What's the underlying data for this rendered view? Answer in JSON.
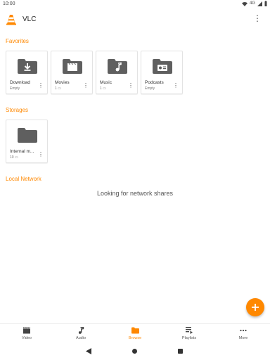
{
  "status": {
    "time": "10:00",
    "network": "4G"
  },
  "app": {
    "title": "VLC"
  },
  "favorites": {
    "title": "Favorites",
    "items": [
      {
        "name": "Download",
        "sub": "Empty",
        "icon": "download-folder-icon"
      },
      {
        "name": "Movies",
        "sub": "1",
        "icon": "movies-folder-icon"
      },
      {
        "name": "Music",
        "sub": "1",
        "icon": "music-folder-icon"
      },
      {
        "name": "Podcasts",
        "sub": "Empty",
        "icon": "podcasts-folder-icon"
      }
    ]
  },
  "storages": {
    "title": "Storages",
    "items": [
      {
        "name": "Internal m...",
        "sub": "10",
        "icon": "folder-icon"
      }
    ]
  },
  "network": {
    "title": "Local Network",
    "message": "Looking for network shares"
  },
  "nav": [
    {
      "label": "Video",
      "icon": "video-icon"
    },
    {
      "label": "Audio",
      "icon": "audio-icon"
    },
    {
      "label": "Browse",
      "icon": "browse-folder-icon",
      "active": true
    },
    {
      "label": "Playlists",
      "icon": "playlist-icon"
    },
    {
      "label": "More",
      "icon": "more-icon"
    }
  ],
  "colors": {
    "accent": "#ff8800",
    "folder": "#5f5f5f"
  }
}
